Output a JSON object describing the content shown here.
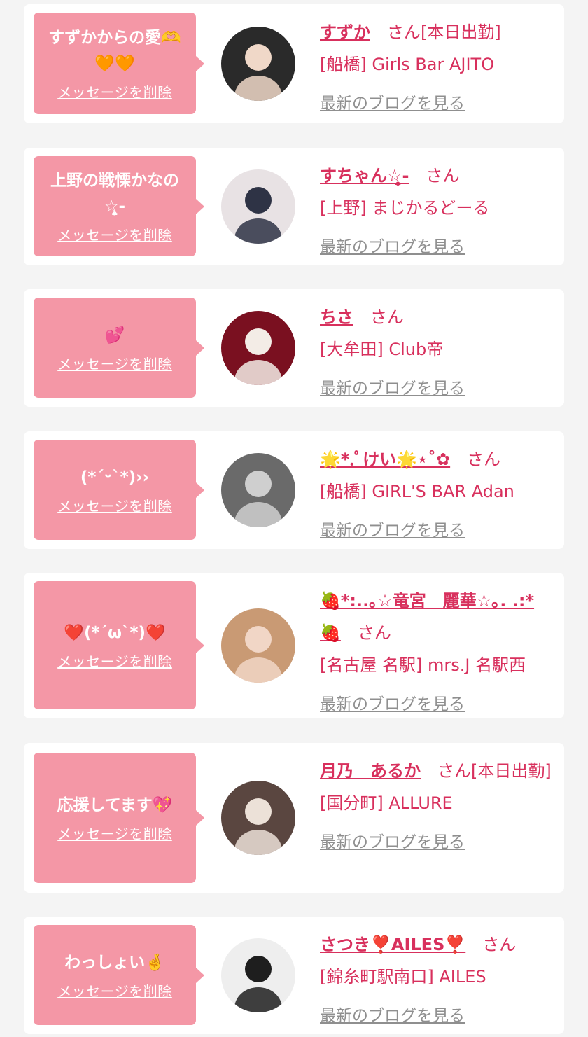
{
  "delete_label": "メッセージを削除",
  "blog_label": "最新のブログを見る",
  "san_label": "さん",
  "colors": {
    "background": "#f4f4f4",
    "card": "#ffffff",
    "bubble": "#f497a6",
    "accent": "#d8305d",
    "link_gray": "#8f8f8f"
  },
  "messages": [
    {
      "message": "すずかからの愛🫶🧡🧡",
      "name": "すずか",
      "status": "[本日出勤]",
      "shop": "[船橋] Girls Bar AJITO",
      "avatar_colors": [
        "#2a2a2a",
        "#f0d8c8"
      ]
    },
    {
      "message": "上野の戦慄かなの ☆̤̥̣-",
      "name": "すちゃん☆̤̥̣-",
      "status": "",
      "shop": "[上野] まじかるどーる",
      "avatar_colors": [
        "#e8e2e4",
        "#2e3345"
      ]
    },
    {
      "message": "💕",
      "name": "ちさ",
      "status": "",
      "shop": "[大牟田] Club帝",
      "avatar_colors": [
        "#7a1020",
        "#f3ece6"
      ]
    },
    {
      "message": "(*ˊᵕˋ*)››",
      "name": "🌟*.ﾟけい🌟⋆˚✿",
      "status": "",
      "shop": "[船橋] GIRL'S BAR Adan",
      "avatar_colors": [
        "#6a6a6a",
        "#cfcfcf"
      ]
    },
    {
      "message": "❤️(*´ω`*)❤️",
      "name": "🍓*:..｡☆竜宮　麗華☆｡. .:*🍓",
      "status": "",
      "shop": "[名古屋 名駅] mrs.J 名駅西",
      "avatar_colors": [
        "#c99a74",
        "#f1d6c6"
      ]
    },
    {
      "message": "応援してます💖",
      "name": "月乃　あるか",
      "status": "[本日出勤]",
      "shop": "[国分町] ALLURE",
      "avatar_colors": [
        "#5a4640",
        "#ece1d8"
      ]
    },
    {
      "message": "わっしょい🤞",
      "name": "さつき❣️AILES❣️",
      "status": "",
      "shop": "[錦糸町駅南口] AILES",
      "avatar_colors": [
        "#eeeeee",
        "#1e1e1e"
      ]
    }
  ]
}
